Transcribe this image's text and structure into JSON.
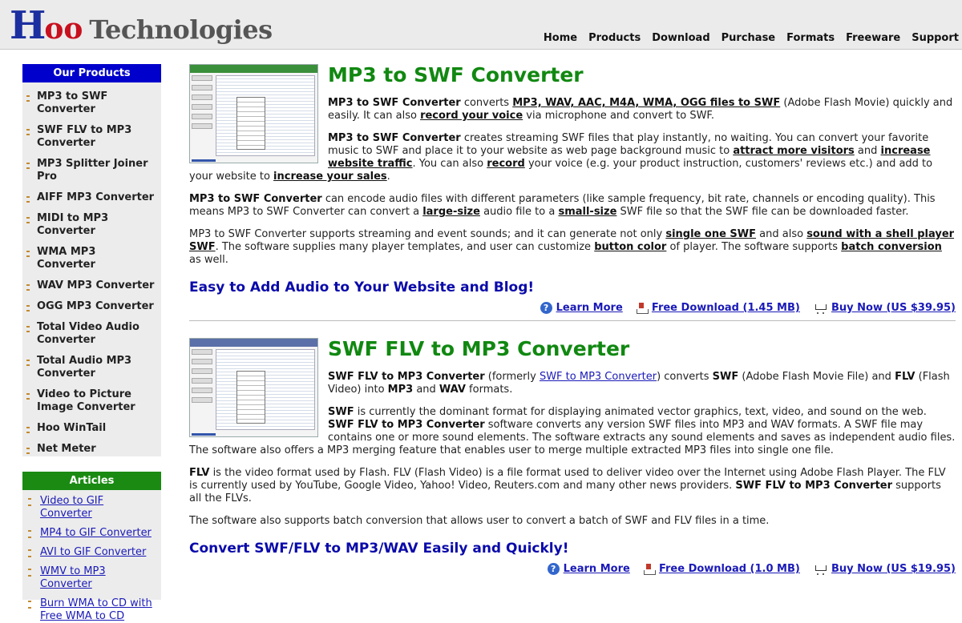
{
  "header": {
    "logo_h": "H",
    "logo_oo": "oo",
    "logo_tech": "Technologies",
    "nav": [
      "Home",
      "Products",
      "Download",
      "Purchase",
      "Formats",
      "Freeware",
      "Support"
    ]
  },
  "sidebar": {
    "products_title": "Our Products",
    "products": [
      "MP3 to SWF Converter",
      "SWF FLV to MP3 Converter",
      "MP3 Splitter Joiner Pro",
      "AIFF MP3 Converter",
      "MIDI to MP3 Converter",
      "WMA MP3 Converter",
      "WAV MP3 Converter",
      "OGG MP3 Converter",
      "Total Video Audio Converter",
      "Total Audio MP3 Converter",
      "Video to Picture Image Converter",
      "Hoo WinTail",
      "Net Meter"
    ],
    "articles_title": "Articles",
    "articles": [
      "Video to GIF Converter",
      "MP4 to GIF Converter",
      "AVI to GIF Converter",
      "WMV to MP3 Converter",
      "Burn WMA to CD with Free WMA to CD"
    ]
  },
  "section1": {
    "title": "MP3 to SWF Converter",
    "p1": {
      "b1": "MP3 to SWF Converter",
      "t1": " converts ",
      "u1": "MP3, WAV, AAC, M4A, WMA, OGG files to SWF",
      "t2": " (Adobe Flash Movie) quickly and easily. It can also ",
      "u2": "record your voice",
      "t3": " via microphone and convert to SWF."
    },
    "p2": {
      "b1": "MP3 to SWF Converter",
      "t1": " creates streaming SWF files that play instantly, no waiting. You can convert your favorite music to SWF and place it to your website as web page background music to ",
      "u1": "attract more visitors",
      "t2": " and ",
      "u2": "increase website traffic",
      "t3": ". You can also ",
      "u3": "record",
      "t4": " your voice (e.g. your product instruction, customers' reviews etc.) and add to your website to ",
      "u4": "increase your sales",
      "t5": "."
    },
    "p3": {
      "b1": "MP3 to SWF Converter",
      "t1": " can encode audio files with different parameters (like sample frequency, bit rate, channels or encoding quality). This means MP3 to SWF Converter can convert a ",
      "u1": "large-size",
      "t2": " audio file to a ",
      "u2": "small-size",
      "t3": " SWF file so that the SWF file can be downloaded faster."
    },
    "p4": {
      "t1": "MP3 to SWF Converter supports streaming and event sounds; and it can generate not only ",
      "u1": "single one SWF",
      "t2": " and also ",
      "u2": "sound with a shell player SWF",
      "t3": ". The software supplies many player templates, and user can customize ",
      "u3": "button color",
      "t4": " of player. The software supports ",
      "u4": "batch conversion",
      "t5": " as well."
    },
    "tagline": "Easy to Add Audio to Your Website and Blog!",
    "learn": "Learn More",
    "download": "Free Download (1.45 MB)",
    "buy": "Buy Now (US $39.95)"
  },
  "section2": {
    "title": "SWF FLV to MP3 Converter",
    "p1": {
      "b1": "SWF FLV to MP3 Converter",
      "t1": " (formerly ",
      "l1": "SWF to MP3 Converter",
      "t2": ") converts ",
      "b2": "SWF",
      "t3": " (Adobe Flash Movie File) and ",
      "b3": "FLV",
      "t4": " (Flash Video) into ",
      "b4": "MP3",
      "t5": " and ",
      "b5": "WAV",
      "t6": " formats."
    },
    "p2": {
      "b1": "SWF",
      "t1": " is currently the dominant format for displaying animated vector graphics, text, video, and sound on the web. ",
      "b2": "SWF FLV to MP3 Converter",
      "t2": " software converts any version SWF files into MP3 and WAV formats. A SWF file may contains one or more sound elements. The software extracts any sound elements and saves as independent audio files. The software also offers a MP3 merging feature that enables user to merge multiple extracted MP3 files into single one file."
    },
    "p3": {
      "b1": "FLV",
      "t1": " is the video format used by Flash. FLV (Flash Video) is a file format used to deliver video over the Internet using Adobe Flash Player. The FLV is currently used by YouTube, Google Video, Yahoo! Video, Reuters.com and many other news providers. ",
      "b2": "SWF FLV to MP3 Converter",
      "t2": " supports all the FLVs."
    },
    "p4": "The software also supports batch conversion that allows user to convert a batch of SWF and FLV files in a time.",
    "tagline": "Convert SWF/FLV to MP3/WAV Easily and Quickly!",
    "learn": "Learn More",
    "download": "Free Download (1.0 MB)",
    "buy": "Buy Now (US $19.95)"
  },
  "colors": {
    "nav_blue": "#0000cc",
    "nav_green": "#1a8a12",
    "title_green": "#118811",
    "link_blue": "#1a1ab8"
  }
}
